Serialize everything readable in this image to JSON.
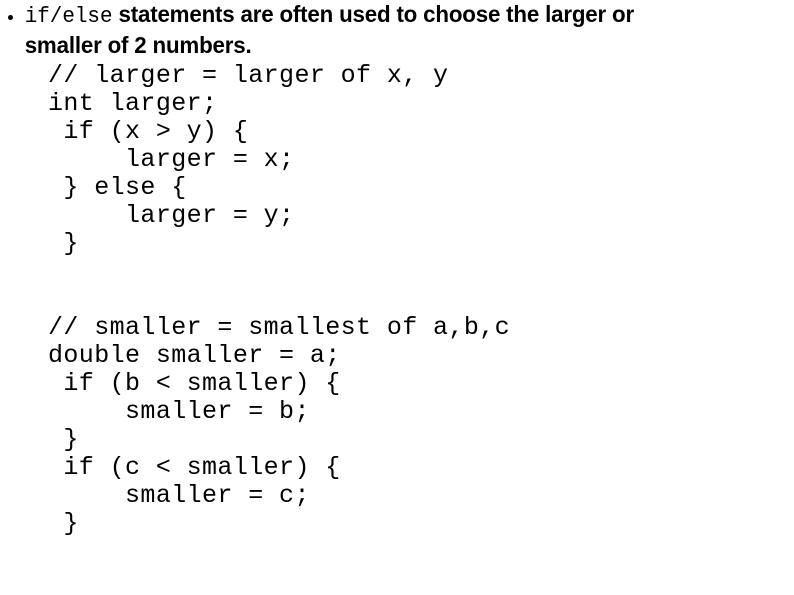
{
  "slide": {
    "background_color": "#ffffff",
    "text_color": "#000000",
    "bullet": {
      "marker": "bullet-dot",
      "mono_lead": "if/else",
      "rest": " statements are often used to choose the larger or smaller of 2 numbers.",
      "full_text": "if/else statements are often used to choose the larger or smaller of 2 numbers."
    },
    "code_blocks": [
      {
        "name": "larger-example",
        "lines": [
          "// larger = larger of x, y",
          "int larger;",
          " if (x > y) {",
          "     larger = x;",
          " } else {",
          "     larger = y;",
          " }"
        ]
      },
      {
        "name": "smaller-example",
        "lines": [
          "// smaller = smallest of a,b,c",
          "double smaller = a;",
          " if (b < smaller) {",
          "     smaller = b;",
          " }",
          " if (c < smaller) {",
          "     smaller = c;",
          " }"
        ]
      }
    ],
    "block_separator": ""
  }
}
